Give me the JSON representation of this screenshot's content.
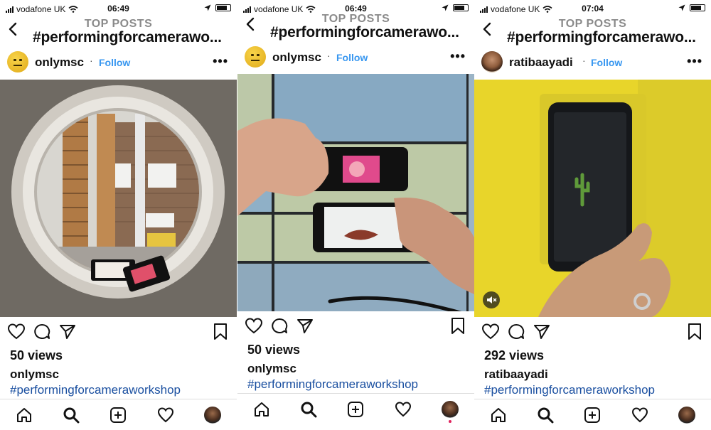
{
  "screens": [
    {
      "status": {
        "carrier": "vodafone UK",
        "time": "06:49"
      },
      "nav": {
        "section_label": "TOP POSTS",
        "title": "#performingforcamerawo..."
      },
      "post": {
        "username": "onlymsc",
        "follow": "Follow",
        "views": "50 views",
        "caption_user": "onlymsc",
        "hashtag": "#performingforcameraworkshop"
      }
    },
    {
      "status": {
        "carrier": "vodafone UK",
        "time": "06:49"
      },
      "nav": {
        "section_label": "TOP POSTS",
        "title": "#performingforcamerawo..."
      },
      "post": {
        "username": "onlymsc",
        "follow": "Follow",
        "views": "50 views",
        "caption_user": "onlymsc",
        "hashtag": "#performingforcameraworkshop"
      }
    },
    {
      "status": {
        "carrier": "vodafone UK",
        "time": "07:04"
      },
      "nav": {
        "section_label": "TOP POSTS",
        "title": "#performingforcamerawo..."
      },
      "post": {
        "username": "ratibaayadi",
        "follow": "Follow",
        "views": "292 views",
        "caption_user": "ratibaayadi",
        "hashtag": "#performingforcameraworkshop"
      }
    }
  ],
  "common": {
    "separator": "·",
    "more": "•••"
  },
  "colors": {
    "follow_blue": "#3897f0",
    "hashtag_blue": "#1a4fa0",
    "top_posts_gray": "#8a8a8a",
    "notification_red": "#e0245e"
  },
  "icons": [
    "signal-bars-icon",
    "wifi-icon",
    "location-arrow-icon",
    "battery-icon",
    "back-chevron-icon",
    "more-dots-icon",
    "heart-icon",
    "comment-icon",
    "share-icon",
    "bookmark-icon",
    "home-icon",
    "search-icon",
    "new-post-icon",
    "activity-heart-icon",
    "profile-avatar-icon",
    "mute-icon"
  ]
}
